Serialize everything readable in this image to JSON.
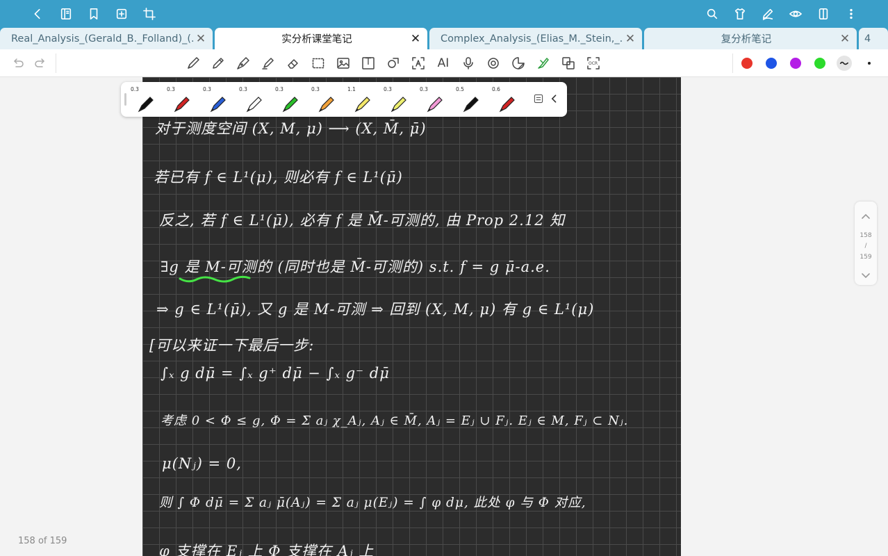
{
  "app_bar": {
    "left_icons": [
      "back-icon",
      "notebook-icon",
      "bookmark-icon",
      "add-page-icon",
      "crop-icon"
    ],
    "right_icons": [
      "search-icon",
      "shirt-icon",
      "pen-mode-icon",
      "eye-icon",
      "layout-icon",
      "more-vertical-icon"
    ]
  },
  "tabs": [
    {
      "label": "Real_Analysis_(Gerald_B._Folland)_(...",
      "active": false
    },
    {
      "label": "实分析课堂笔记",
      "active": true
    },
    {
      "label": "Complex_Analysis_(Elias_M._Stein,_...",
      "active": false
    },
    {
      "label": "复分析笔记",
      "active": false
    },
    {
      "label": "4",
      "active": false
    }
  ],
  "toolbar": {
    "ocr_label": "OCR",
    "text_tool_label": "T",
    "ai_label": "AI",
    "colors": [
      "#e8352b",
      "#1e55e6",
      "#b41ee6",
      "#2cdb2c"
    ],
    "tools": [
      "undo-icon",
      "redo-icon",
      "pen-icon",
      "pencil-icon",
      "fountain-pen-icon",
      "highlighter-icon",
      "eraser-icon",
      "lasso-select-icon",
      "image-icon",
      "text-tool-icon",
      "shape-icon",
      "text-recognition-icon",
      "ai-icon",
      "microphone-icon",
      "stamp-icon",
      "sticker-icon",
      "laser-pointer-icon",
      "translate-icon",
      "ocr-icon"
    ]
  },
  "pen_tray": {
    "pens": [
      {
        "size": "0.3",
        "color": "#111111"
      },
      {
        "size": "0.3",
        "color": "#d02424"
      },
      {
        "size": "0.3",
        "color": "#2a5fd6"
      },
      {
        "size": "0.3",
        "color": "#ffffff"
      },
      {
        "size": "0.3",
        "color": "#2bbf2b"
      },
      {
        "size": "0.3",
        "color": "#f2a23a"
      },
      {
        "size": "1.1",
        "color": "#f4e86a"
      },
      {
        "size": "0.3",
        "color": "#eef070"
      },
      {
        "size": "0.3",
        "color": "#f29ad6"
      },
      {
        "size": "0.5",
        "color": "#111111"
      },
      {
        "size": "0.6",
        "color": "#d02424"
      }
    ]
  },
  "notes": [
    "对于测度空间 (X, M, μ) ⟶ (X, M̄, μ̄)",
    "若已有 f ∈ L¹(μ), 则必有 f ∈ L¹(μ̄)",
    "反之, 若 f ∈ L¹(μ̄), 必有 f 是 M̄-可测的, 由 Prop 2.12 知",
    "∃g 是 M-可测的 (同时也是 M̄-可测的) s.t. f = g μ̄-a.e.",
    "⇒ g ∈ L¹(μ̄), 又 g 是 M-可测 ⇒ 回到 (X, M, μ) 有 g ∈ L¹(μ)",
    "[可以来证一下最后一步:",
    "∫ₓ g dμ̄ = ∫ₓ g⁺ dμ̄ − ∫ₓ g⁻ dμ̄",
    "考虑 0 < Φ ≤ g, Φ = Σ aⱼ χ_Aⱼ, Aⱼ ∈ M̄, Aⱼ = Eⱼ ∪ Fⱼ. Eⱼ ∈ M, Fⱼ ⊂ Nⱼ.",
    "μ(Nⱼ) = 0,",
    "则 ∫ Φ dμ̄ = Σ aⱼ μ̄(Aⱼ) = Σ aⱼ μ(Eⱼ) = ∫ φ dμ, 此处 φ 与 Φ 对应,",
    "φ 支撑在 Eⱼ 上 Φ 支撑在 Aⱼ 上"
  ],
  "page_nav": {
    "current": "158",
    "separator": "/",
    "total": "159"
  },
  "page_count": "158 of 159"
}
